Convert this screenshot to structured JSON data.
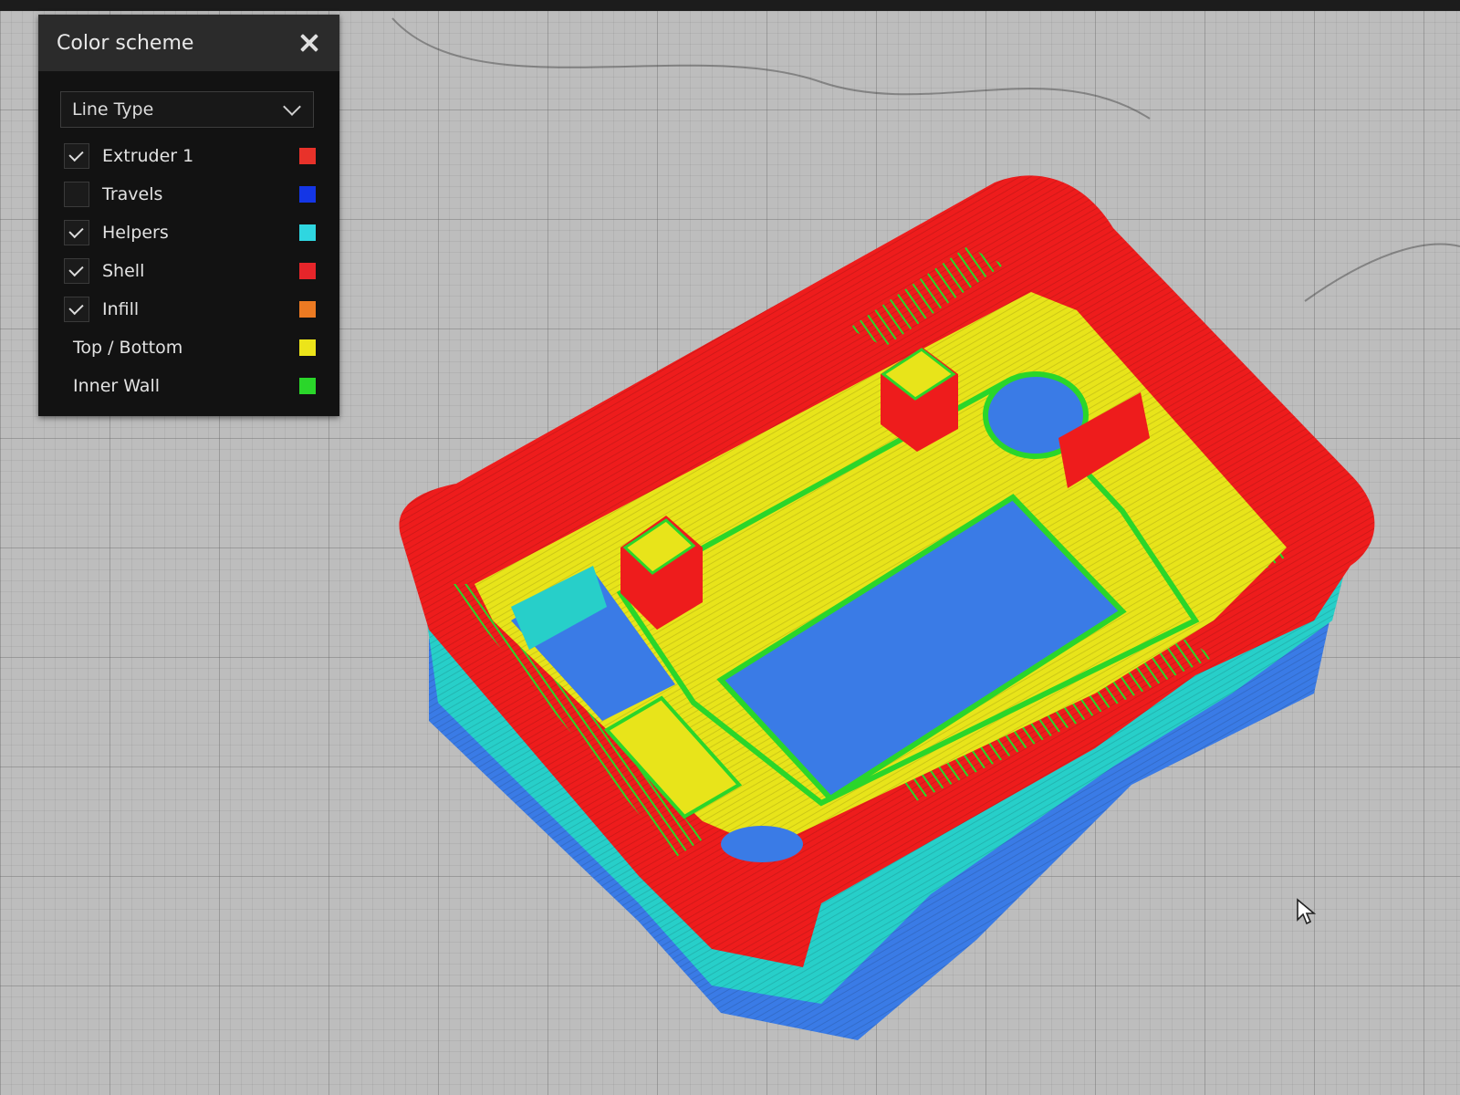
{
  "color_scheme_panel": {
    "title": "Color scheme",
    "scheme_select": {
      "value": "Line Type"
    },
    "legend": [
      {
        "label": "Extruder 1",
        "checked": true,
        "has_checkbox": true,
        "color": "#e8322a"
      },
      {
        "label": "Travels",
        "checked": false,
        "has_checkbox": true,
        "color": "#1436e6"
      },
      {
        "label": "Helpers",
        "checked": true,
        "has_checkbox": true,
        "color": "#2fd6e0"
      },
      {
        "label": "Shell",
        "checked": true,
        "has_checkbox": true,
        "color": "#e6252a"
      },
      {
        "label": "Infill",
        "checked": true,
        "has_checkbox": true,
        "color": "#ec7a22"
      },
      {
        "label": "Top / Bottom",
        "has_checkbox": false,
        "color": "#ece41a"
      },
      {
        "label": "Inner Wall",
        "has_checkbox": false,
        "color": "#2ad62a"
      }
    ]
  },
  "icons": {
    "close": "close-icon",
    "dropdown": "chevron-down-icon",
    "cursor": "mouse-pointer-icon"
  },
  "model_colors": {
    "shell": "#ee1c1c",
    "top_bottom": "#e8e41a",
    "inner_wall": "#2ad62a",
    "helpers": "#27cfc9",
    "travel_blue": "#3a7be6"
  }
}
